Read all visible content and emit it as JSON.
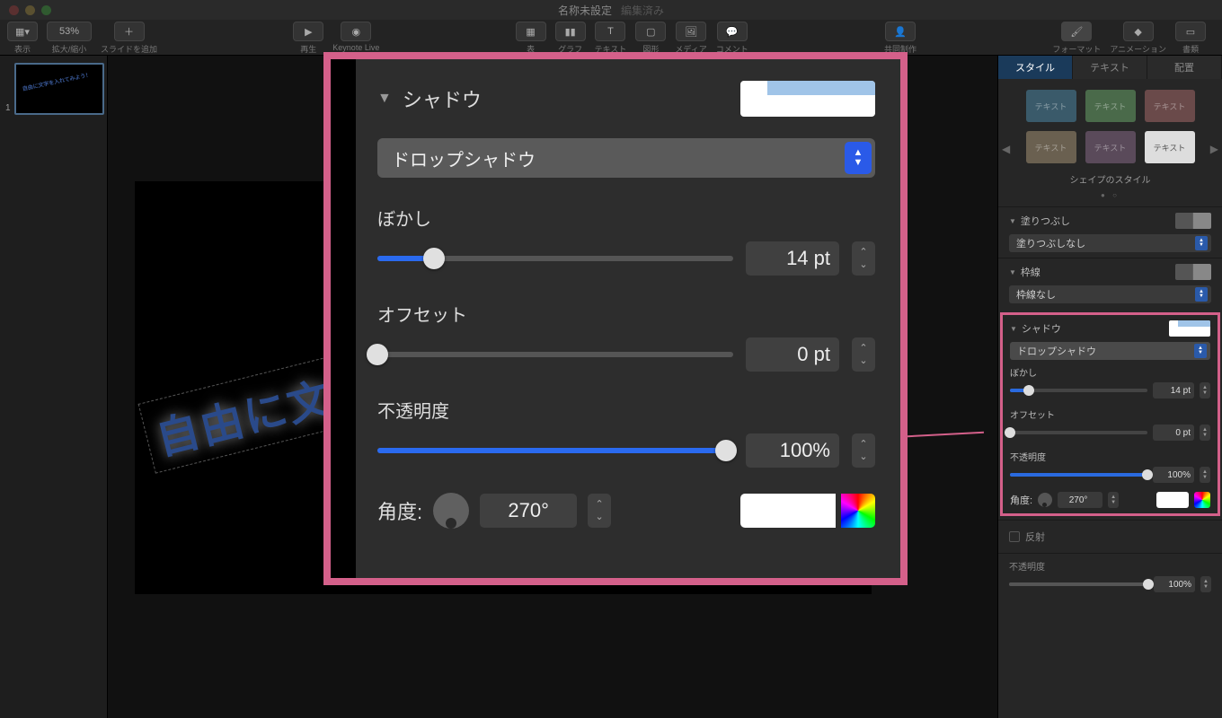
{
  "window": {
    "title": "名称未設定",
    "subtitle": "編集済み"
  },
  "toolbar": {
    "view_label": "表示",
    "zoom_value": "53%",
    "zoom_label": "拡大/縮小",
    "add_slide_label": "スライドを追加",
    "play_label": "再生",
    "keynote_live_label": "Keynote Live",
    "table_label": "表",
    "chart_label": "グラフ",
    "text_label": "テキスト",
    "shape_label": "図形",
    "media_label": "メディア",
    "comment_label": "コメント",
    "collab_label": "共同制作",
    "format_label": "フォーマット",
    "animate_label": "アニメーション",
    "document_label": "書類"
  },
  "thumb": {
    "number": "1",
    "text": "自由に文字を入れてみよう！"
  },
  "canvas": {
    "text": "自由に文"
  },
  "inspector": {
    "tabs": {
      "style": "スタイル",
      "text": "テキスト",
      "arrange": "配置"
    },
    "swatch_txt": "テキスト",
    "shape_styles": "シェイプのスタイル",
    "fill": {
      "title": "塗りつぶし",
      "value": "塗りつぶしなし"
    },
    "border": {
      "title": "枠線",
      "value": "枠線なし"
    },
    "shadow": {
      "title": "シャドウ",
      "type": "ドロップシャドウ",
      "blur_label": "ぼかし",
      "blur_value": "14 pt",
      "offset_label": "オフセット",
      "offset_value": "0 pt",
      "opacity_label": "不透明度",
      "opacity_value": "100%",
      "angle_label": "角度:",
      "angle_value": "270°"
    },
    "reflection": "反射",
    "opacity": {
      "label": "不透明度",
      "value": "100%"
    }
  },
  "callout": {
    "title": "シャドウ",
    "type": "ドロップシャドウ",
    "blur_label": "ぼかし",
    "blur_value": "14 pt",
    "offset_label": "オフセット",
    "offset_value": "0 pt",
    "opacity_label": "不透明度",
    "opacity_value": "100%",
    "angle_label": "角度:",
    "angle_value": "270°"
  }
}
